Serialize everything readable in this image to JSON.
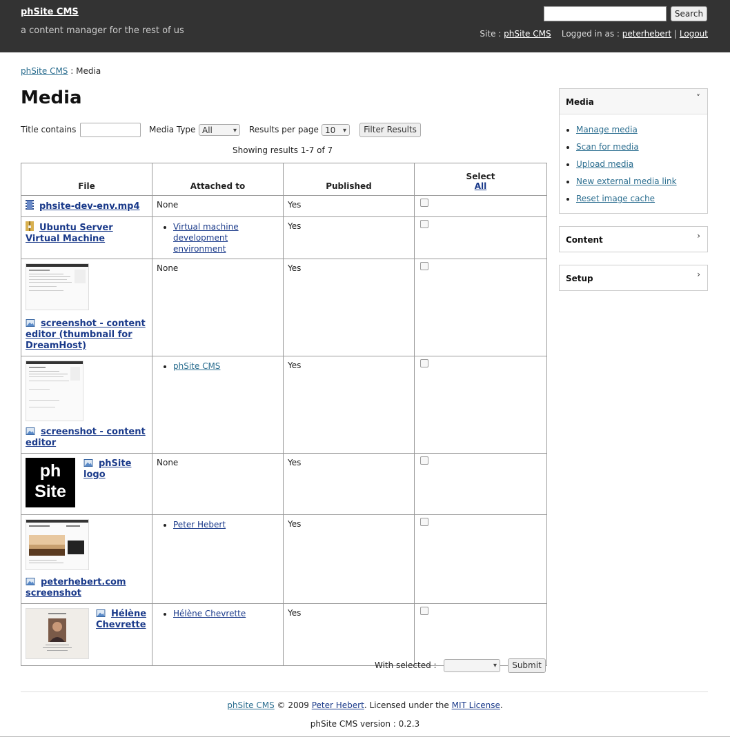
{
  "header": {
    "site_name": "phSite CMS",
    "tagline": "a content manager for the rest of us",
    "search_button": "Search",
    "site_label": "Site :",
    "site_link": "phSite CMS",
    "logged_in_label": "Logged in as :",
    "username": "peterhebert",
    "separator": "|",
    "logout": "Logout"
  },
  "breadcrumb": {
    "home": "phSite CMS",
    "sep": ":",
    "current": "Media"
  },
  "page_title": "Media",
  "filters": {
    "title_label": "Title contains",
    "title_value": "",
    "media_type_label": "Media Type",
    "media_type_value": "All",
    "per_page_label": "Results per page",
    "per_page_value": "10",
    "filter_button": "Filter Results"
  },
  "showing": "Showing results 1-7 of 7",
  "table": {
    "headers": {
      "file": "File",
      "attached": "Attached to",
      "published": "Published",
      "select": "Select",
      "select_all": "All"
    },
    "rows": [
      {
        "file": "phsite-dev-env.mp4",
        "icon": "video-icon",
        "attached": "None",
        "published": "Yes"
      },
      {
        "file": "Ubuntu Server Virtual Machine",
        "icon": "archive-icon",
        "attached": [
          "Virtual machine development environment"
        ],
        "published": "Yes"
      },
      {
        "file": "screenshot - content editor (thumbnail for DreamHost)",
        "icon": "image-icon",
        "attached": "None",
        "published": "Yes"
      },
      {
        "file": "screenshot - content editor",
        "icon": "image-icon",
        "attached": [
          "phSite CMS"
        ],
        "published": "Yes"
      },
      {
        "file": "phSite logo",
        "icon": "image-icon",
        "logo_text_1": "ph",
        "logo_text_2": "Site",
        "attached": "None",
        "published": "Yes"
      },
      {
        "file": "peterhebert.com screenshot",
        "icon": "image-icon",
        "attached": [
          "Peter Hebert"
        ],
        "published": "Yes"
      },
      {
        "file": "Hélène Chevrette",
        "icon": "image-icon",
        "attached": [
          "Hélène Chevrette"
        ],
        "published": "Yes"
      }
    ]
  },
  "bulk": {
    "label": "With selected :",
    "action_value": "",
    "submit": "Submit"
  },
  "sidebar": {
    "media": {
      "title": "Media",
      "chevron": "˅",
      "links": [
        "Manage media",
        "Scan for media",
        "Upload media",
        "New external media link",
        "Reset image cache"
      ]
    },
    "content": {
      "title": "Content",
      "chevron": "›"
    },
    "setup": {
      "title": "Setup",
      "chevron": "›"
    }
  },
  "footer": {
    "link1": "phSite CMS",
    "text1": "© 2009",
    "link2": "Peter Hebert",
    "text2": ". Licensed under the",
    "link3": "MIT License",
    "text3": ".",
    "version": "phSite CMS version : 0.2.3"
  },
  "colors": {
    "topbar": "#333333",
    "link": "#1a3a8a",
    "accent_link": "#2a6d8f"
  }
}
